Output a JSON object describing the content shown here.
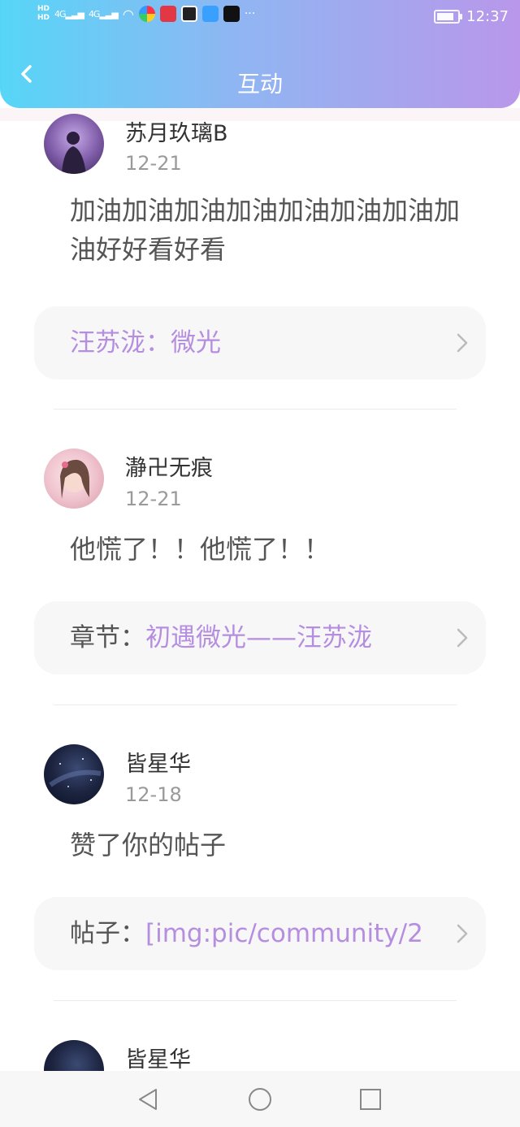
{
  "status_bar": {
    "time": "12:37",
    "network_1": "4G",
    "network_2": "4G",
    "hd_1": "HD",
    "hd_2": "HD",
    "more": "···"
  },
  "header": {
    "title": "互动"
  },
  "items": [
    {
      "username": "苏月玖璃B",
      "date": "12-21",
      "message": "加油加油加油加油加油加油加油加油好好看好看",
      "link_prefix": "",
      "link_value": "汪苏泷：微光"
    },
    {
      "username": "瀞卍无痕",
      "date": "12-21",
      "message": "他慌了！！他慌了！！",
      "link_prefix": "章节：",
      "link_value": "初遇微光——汪苏泷"
    },
    {
      "username": "皆星华",
      "date": "12-18",
      "message": "赞了你的帖子",
      "link_prefix": "帖子：",
      "link_value": "[img:pic/community/2"
    },
    {
      "username": "皆星华"
    }
  ],
  "colors": {
    "header_gradient": [
      "#56d6f7",
      "#8fb6f2",
      "#b997ea"
    ],
    "accent": "#b58ee0"
  }
}
